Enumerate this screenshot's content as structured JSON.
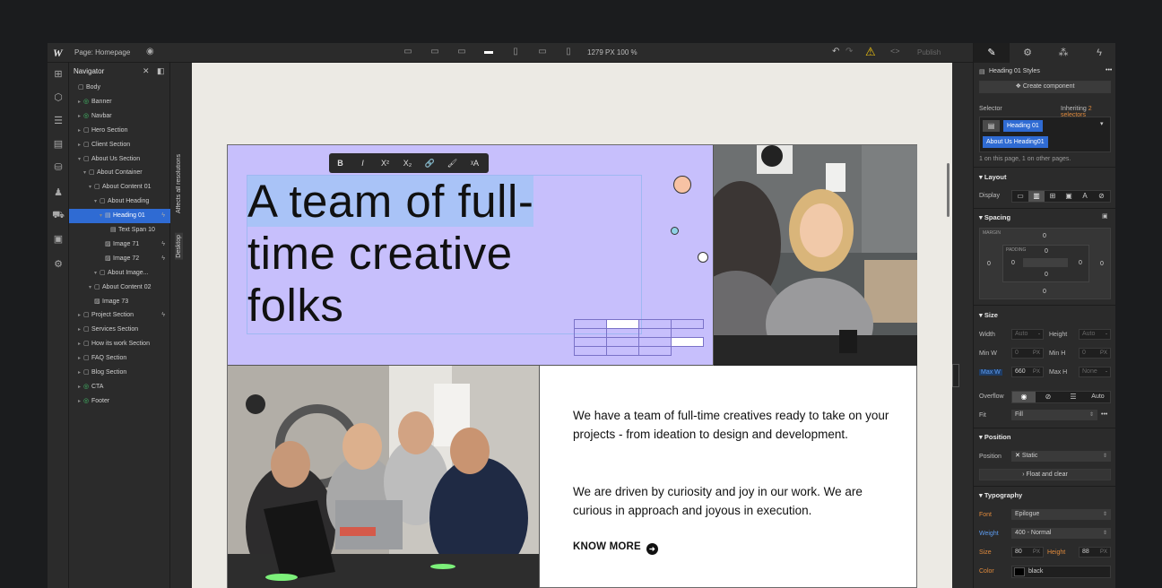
{
  "topbar": {
    "page_label": "Page: Homepage",
    "zoom_readout": "1279 PX  100 %",
    "publish_label": "Publish"
  },
  "navigator": {
    "title": "Navigator",
    "items": [
      {
        "label": "Body",
        "depth": 0
      },
      {
        "label": "Banner",
        "depth": 1,
        "component": true
      },
      {
        "label": "Navbar",
        "depth": 1,
        "component": true
      },
      {
        "label": "Hero Section",
        "depth": 1
      },
      {
        "label": "Client Section",
        "depth": 1
      },
      {
        "label": "About Us Section",
        "depth": 1
      },
      {
        "label": "About Container",
        "depth": 2
      },
      {
        "label": "About Content 01",
        "depth": 3
      },
      {
        "label": "About Heading",
        "depth": 4
      },
      {
        "label": "Heading 01",
        "depth": 5,
        "selected": true
      },
      {
        "label": "Text Span 10",
        "depth": 6
      },
      {
        "label": "Image 71",
        "depth": 5
      },
      {
        "label": "Image 72",
        "depth": 5
      },
      {
        "label": "About Image...",
        "depth": 4
      },
      {
        "label": "About Content 02",
        "depth": 3
      },
      {
        "label": "Image 73",
        "depth": 3
      },
      {
        "label": "Project Section",
        "depth": 1
      },
      {
        "label": "Services Section",
        "depth": 1
      },
      {
        "label": "How its work Section",
        "depth": 1
      },
      {
        "label": "FAQ Section",
        "depth": 1
      },
      {
        "label": "Blog Section",
        "depth": 1
      },
      {
        "label": "CTA",
        "depth": 1,
        "component": true
      },
      {
        "label": "Footer",
        "depth": 1,
        "component": true
      }
    ]
  },
  "vstrip": {
    "affects": "Affects all resolutions",
    "desktop": "Desktop"
  },
  "canvas": {
    "heading_line1": "A team of full-",
    "heading_line2": "time creative",
    "heading_line3": "folks",
    "toolbar": [
      "B",
      "I",
      "X²",
      "X₂",
      "🔗",
      "🖌",
      "ᵡA"
    ],
    "para1": "We have a team of full-time creatives ready to take on your projects - from ideation to design and development.",
    "para2": "We are driven by curiosity and joy in our work. We are curious in approach and joyous in execution.",
    "cta": "KNOW MORE"
  },
  "style_panel": {
    "header": "Heading 01 Styles",
    "create_component": "Create component",
    "selector_label": "Selector",
    "inheriting_prefix": "Inheriting",
    "inheriting_link": "2 selectors",
    "chip1": "Heading 01",
    "chip2": "About Us Heading01",
    "usage": "1 on this page, 1 on other pages.",
    "layout": {
      "title": "Layout",
      "display_label": "Display"
    },
    "spacing": {
      "title": "Spacing",
      "margin_label": "MARGIN",
      "padding_label": "PADDING",
      "margin_top": "0",
      "margin_left": "0",
      "margin_right": "0",
      "margin_bottom": "0",
      "padding_top": "0",
      "padding_left": "0",
      "padding_right": "0",
      "padding_bottom": "0"
    },
    "size": {
      "title": "Size",
      "width_label": "Width",
      "width_value": "Auto",
      "height_label": "Height",
      "height_value": "Auto",
      "minw_label": "Min W",
      "minw_value": "0",
      "minw_unit": "PX",
      "minh_label": "Min H",
      "minh_value": "0",
      "minh_unit": "PX",
      "maxw_label": "Max W",
      "maxw_value": "660",
      "maxw_unit": "PX",
      "maxh_label": "Max H",
      "maxh_value": "None",
      "overflow_label": "Overflow",
      "overflow_auto": "Auto",
      "fit_label": "Fit",
      "fit_value": "Fill"
    },
    "position": {
      "title": "Position",
      "label": "Position",
      "value": "Static",
      "float_clear": "Float and clear"
    },
    "typography": {
      "title": "Typography",
      "font_label": "Font",
      "font_value": "Epilogue",
      "weight_label": "Weight",
      "weight_value": "400 - Normal",
      "size_label": "Size",
      "size_value": "80",
      "size_unit": "PX",
      "height_label": "Height",
      "height_value": "88",
      "height_unit": "PX",
      "color_label": "Color",
      "color_value": "black"
    }
  },
  "colors": {
    "hero_bg": "#c7bffc",
    "selection_blue": "#2f6bd3",
    "text_highlight": "#a9c3f7",
    "warning": "#f1c40f"
  }
}
